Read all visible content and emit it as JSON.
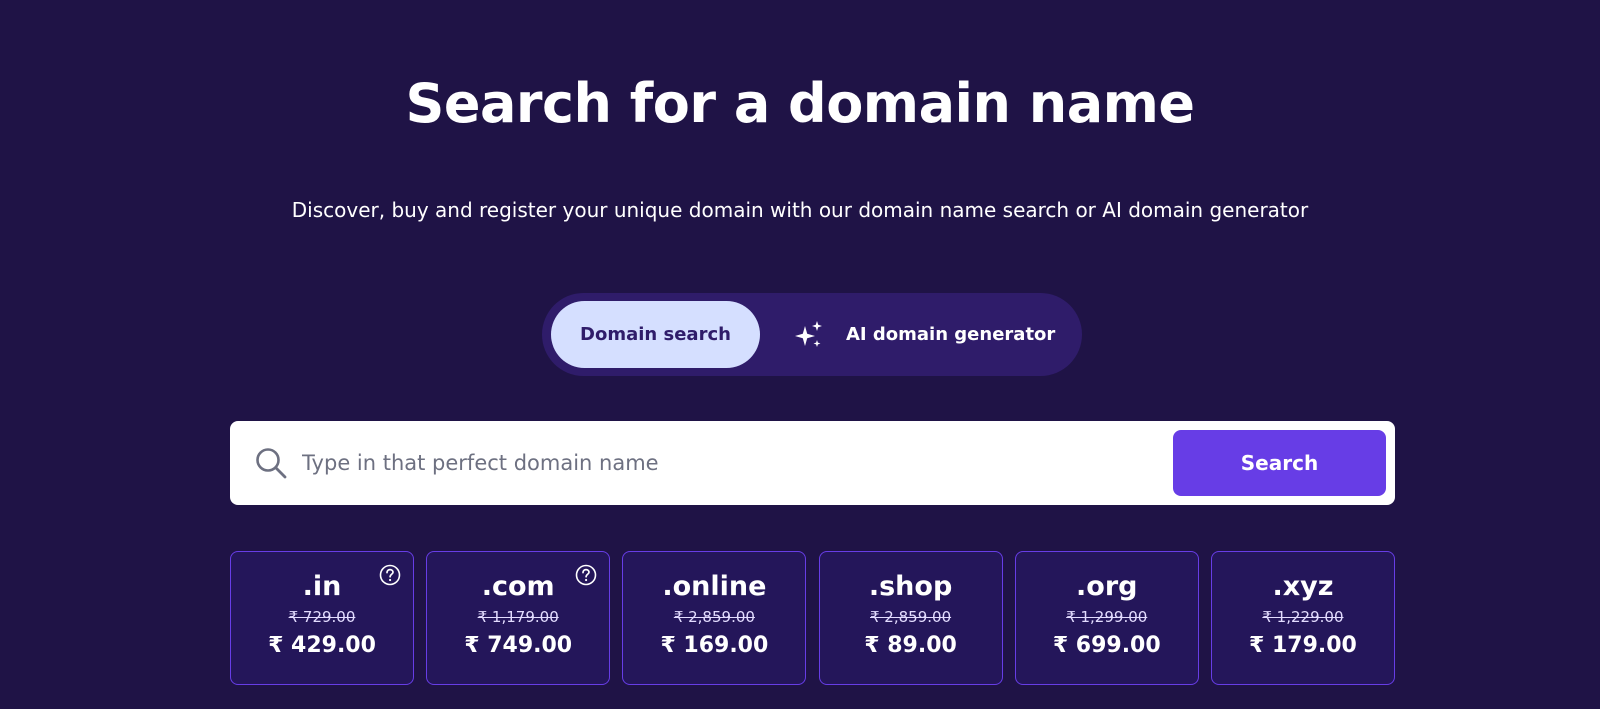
{
  "hero": {
    "title": "Search for a domain name",
    "subtitle": "Discover, buy and register your unique domain with our domain name search or AI domain generator"
  },
  "toggle": {
    "active_label": "Domain search",
    "other_label": "AI domain generator",
    "other_icon": "sparkle-icon"
  },
  "search": {
    "placeholder": "Type in that perfect domain name",
    "value": "",
    "button_label": "Search",
    "icon": "search-icon"
  },
  "tlds": [
    {
      "name": ".in",
      "old_price": "₹ 729.00",
      "price": "₹ 429.00",
      "help": true
    },
    {
      "name": ".com",
      "old_price": "₹ 1,179.00",
      "price": "₹ 749.00",
      "help": true
    },
    {
      "name": ".online",
      "old_price": "₹ 2,859.00",
      "price": "₹ 169.00",
      "help": false
    },
    {
      "name": ".shop",
      "old_price": "₹ 2,859.00",
      "price": "₹ 89.00",
      "help": false
    },
    {
      "name": ".org",
      "old_price": "₹ 1,299.00",
      "price": "₹ 699.00",
      "help": false
    },
    {
      "name": ".xyz",
      "old_price": "₹ 1,229.00",
      "price": "₹ 179.00",
      "help": false
    }
  ],
  "colors": {
    "background": "#1f1346",
    "toggle_bg": "#2f1c6a",
    "toggle_active": "#d5dfff",
    "accent": "#673de6",
    "card_bg": "#24165a"
  }
}
